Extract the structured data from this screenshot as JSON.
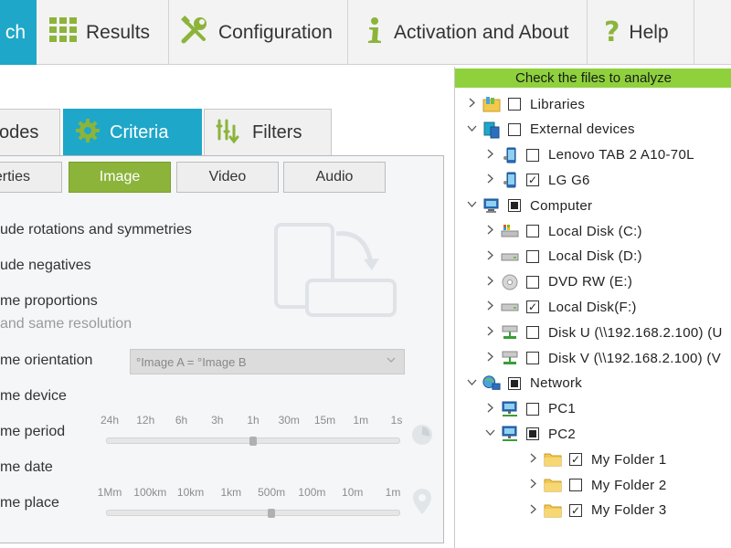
{
  "toolbar": {
    "search_label": "ch",
    "results_label": "Results",
    "configuration_label": "Configuration",
    "activation_label": "Activation and About",
    "help_label": "Help",
    "colors": {
      "active": "#1ea7c9",
      "results_icon": "#8cb43a"
    }
  },
  "main_tabs": {
    "modes_label": "odes",
    "criteria_label": "Criteria",
    "filters_label": "Filters"
  },
  "sub_tabs": {
    "properties_label": "erties",
    "image_label": "Image",
    "video_label": "Video",
    "audio_label": "Audio"
  },
  "options": {
    "rotations": "ude rotations and symmetries",
    "negatives": "ude negatives",
    "proportions": "me proportions",
    "same_resolution": "and same resolution",
    "orientation": "me orientation",
    "orientation_value": "°Image A  = °Image B",
    "device": "me device",
    "period": "me period",
    "date": "me date",
    "place": "me place"
  },
  "period_scale": [
    "24h",
    "12h",
    "6h",
    "3h",
    "1h",
    "30m",
    "15m",
    "1m",
    "1s"
  ],
  "period_value": "1h",
  "place_scale": [
    "1Mm",
    "100km",
    "10km",
    "1km",
    "500m",
    "100m",
    "10m",
    "1m"
  ],
  "place_value": "500m",
  "tree": {
    "header": "Check the files to analyze",
    "header_color": "#8ed13c",
    "rows": [
      {
        "label": "Libraries",
        "icon": "libraries-icon",
        "expand": "collapsed",
        "check": "unchecked"
      },
      {
        "label": "External devices",
        "icon": "devices-icon",
        "expand": "expanded",
        "check": "unchecked"
      },
      {
        "label": "Lenovo TAB 2 A10-70L",
        "icon": "phone-icon",
        "expand": "collapsed",
        "check": "unchecked"
      },
      {
        "label": "LG G6",
        "icon": "phone-icon",
        "expand": "collapsed",
        "check": "checked"
      },
      {
        "label": "Computer",
        "icon": "computer-icon",
        "expand": "expanded",
        "check": "partial"
      },
      {
        "label": "Local Disk (C:)",
        "icon": "system-disk-icon",
        "expand": "collapsed",
        "check": "unchecked"
      },
      {
        "label": "Local Disk (D:)",
        "icon": "disk-icon",
        "expand": "collapsed",
        "check": "unchecked"
      },
      {
        "label": "DVD RW (E:)",
        "icon": "dvd-icon",
        "expand": "collapsed",
        "check": "unchecked"
      },
      {
        "label": "Local Disk(F:)",
        "icon": "disk-icon",
        "expand": "collapsed",
        "check": "checked"
      },
      {
        "label": "Disk U  (\\\\192.168.2.100) (U",
        "icon": "network-drive-icon",
        "expand": "collapsed",
        "check": "unchecked"
      },
      {
        "label": "Disk V  (\\\\192.168.2.100) (V",
        "icon": "network-drive-icon",
        "expand": "collapsed",
        "check": "unchecked"
      },
      {
        "label": "Network",
        "icon": "network-icon",
        "expand": "expanded",
        "check": "partial"
      },
      {
        "label": "PC1",
        "icon": "pc-icon",
        "expand": "collapsed",
        "check": "unchecked"
      },
      {
        "label": "PC2",
        "icon": "pc-icon",
        "expand": "expanded",
        "check": "partial"
      },
      {
        "label": "My Folder 1",
        "icon": "folder-icon",
        "expand": "collapsed",
        "check": "checked"
      },
      {
        "label": "My Folder 2",
        "icon": "folder-icon",
        "expand": "collapsed",
        "check": "unchecked"
      },
      {
        "label": "My Folder 3",
        "icon": "folder-icon",
        "expand": "collapsed",
        "check": "checked"
      }
    ]
  }
}
